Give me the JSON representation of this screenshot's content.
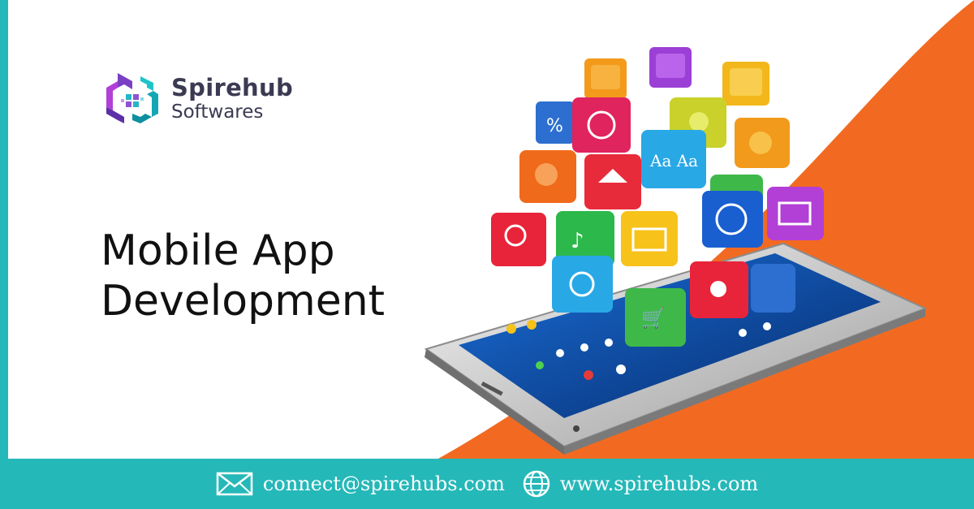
{
  "brand": {
    "name": "Spirehub",
    "subtitle": "Softwares"
  },
  "headline": {
    "line1": "Mobile App",
    "line2": "Development"
  },
  "footer": {
    "email": "connect@spirehubs.com",
    "website": "www.spirehubs.com"
  },
  "colors": {
    "teal": "#25b8b9",
    "orange": "#f26a21",
    "text_dark": "#111111"
  },
  "icons": [
    "mail-icon",
    "globe-icon",
    "spirehub-logo-icon"
  ]
}
